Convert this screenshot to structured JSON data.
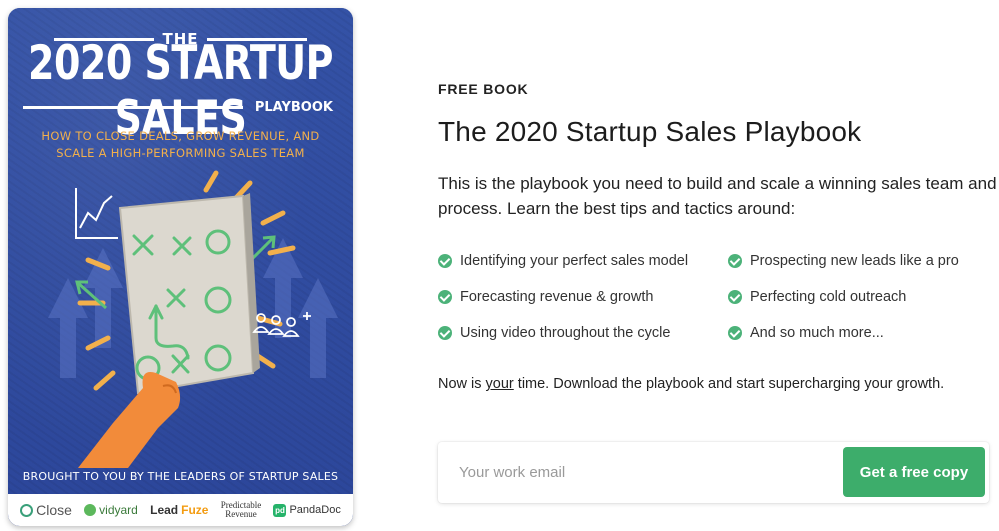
{
  "cover": {
    "the": "THE",
    "title": "2020 STARTUP SALES",
    "playbook": "PLAYBOOK",
    "tagline_line1": "HOW TO CLOSE DEALS, GROW REVENUE, AND",
    "tagline_line2": "SCALE A HIGH-PERFORMING SALES TEAM",
    "footer": "BROUGHT TO YOU BY THE LEADERS OF STARTUP SALES",
    "logos": {
      "close": "Close",
      "vidyard": "vidyard",
      "leadfuze_a": "Lead",
      "leadfuze_b": "Fuze",
      "predictable_1": "Predictable",
      "predictable_2": "Revenue",
      "pandadoc": "PandaDoc",
      "pandadoc_mark": "pd"
    },
    "colors": {
      "background": "#2f4a9c",
      "accent": "#f2b04c",
      "green": "#5ec07a"
    }
  },
  "eyebrow": "FREE BOOK",
  "headline": "The 2020 Startup Sales Playbook",
  "intro": "This is the playbook you need to build and scale a winning sales team and process. Learn the best tips and tactics around:",
  "features": [
    "Identifying your perfect sales model",
    "Prospecting new leads like a pro",
    "Forecasting revenue & growth",
    "Perfecting cold outreach",
    "Using video throughout the cycle",
    "And so much more..."
  ],
  "cta": {
    "before": "Now is ",
    "emphasis": "your",
    "after": " time. Download the playbook and start supercharging your growth."
  },
  "form": {
    "email_placeholder": "Your work email",
    "email_value": "",
    "button_label": "Get a free copy"
  },
  "colors": {
    "accent_green": "#3dad6b",
    "check_green": "#4cb279"
  }
}
